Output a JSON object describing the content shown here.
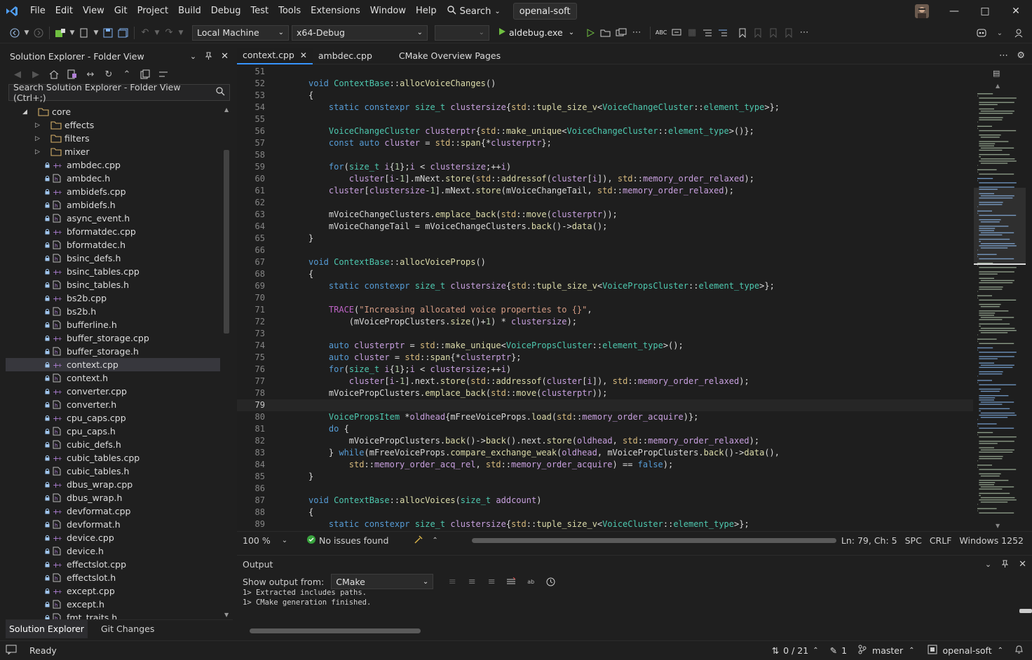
{
  "menu": {
    "items": [
      "File",
      "Edit",
      "View",
      "Git",
      "Project",
      "Build",
      "Debug",
      "Test",
      "Tools",
      "Extensions",
      "Window",
      "Help"
    ],
    "search_label": "Search",
    "solution_name": "openal-soft"
  },
  "toolbar": {
    "target_machine": "Local Machine",
    "configuration": "x64-Debug",
    "empty_dropdown": "",
    "startup_item": "aldebug.exe"
  },
  "sidebar": {
    "title": "Solution Explorer - Folder View",
    "search_placeholder": "Search Solution Explorer - Folder View (Ctrl+;)",
    "tree": [
      {
        "label": "core",
        "type": "folder",
        "expanded": true,
        "level": 1
      },
      {
        "label": "effects",
        "type": "folder",
        "expanded": false,
        "level": 2
      },
      {
        "label": "filters",
        "type": "folder",
        "expanded": false,
        "level": 2
      },
      {
        "label": "mixer",
        "type": "folder",
        "expanded": false,
        "level": 2
      },
      {
        "label": "ambdec.cpp",
        "type": "cpp"
      },
      {
        "label": "ambdec.h",
        "type": "h"
      },
      {
        "label": "ambidefs.cpp",
        "type": "cpp"
      },
      {
        "label": "ambidefs.h",
        "type": "h"
      },
      {
        "label": "async_event.h",
        "type": "h"
      },
      {
        "label": "bformatdec.cpp",
        "type": "cpp"
      },
      {
        "label": "bformatdec.h",
        "type": "h"
      },
      {
        "label": "bsinc_defs.h",
        "type": "h"
      },
      {
        "label": "bsinc_tables.cpp",
        "type": "cpp"
      },
      {
        "label": "bsinc_tables.h",
        "type": "h"
      },
      {
        "label": "bs2b.cpp",
        "type": "cpp"
      },
      {
        "label": "bs2b.h",
        "type": "h"
      },
      {
        "label": "bufferline.h",
        "type": "h"
      },
      {
        "label": "buffer_storage.cpp",
        "type": "cpp"
      },
      {
        "label": "buffer_storage.h",
        "type": "h"
      },
      {
        "label": "context.cpp",
        "type": "cpp",
        "selected": true
      },
      {
        "label": "context.h",
        "type": "h"
      },
      {
        "label": "converter.cpp",
        "type": "cpp"
      },
      {
        "label": "converter.h",
        "type": "h"
      },
      {
        "label": "cpu_caps.cpp",
        "type": "cpp"
      },
      {
        "label": "cpu_caps.h",
        "type": "h"
      },
      {
        "label": "cubic_defs.h",
        "type": "h"
      },
      {
        "label": "cubic_tables.cpp",
        "type": "cpp"
      },
      {
        "label": "cubic_tables.h",
        "type": "h"
      },
      {
        "label": "dbus_wrap.cpp",
        "type": "cpp"
      },
      {
        "label": "dbus_wrap.h",
        "type": "h"
      },
      {
        "label": "devformat.cpp",
        "type": "cpp"
      },
      {
        "label": "devformat.h",
        "type": "h"
      },
      {
        "label": "device.cpp",
        "type": "cpp"
      },
      {
        "label": "device.h",
        "type": "h"
      },
      {
        "label": "effectslot.cpp",
        "type": "cpp"
      },
      {
        "label": "effectslot.h",
        "type": "h"
      },
      {
        "label": "except.cpp",
        "type": "cpp"
      },
      {
        "label": "except.h",
        "type": "h"
      },
      {
        "label": "fmt_traits.h",
        "type": "h"
      }
    ],
    "tabs": [
      "Solution Explorer",
      "Git Changes"
    ]
  },
  "editor": {
    "tabs": [
      {
        "label": "context.cpp",
        "active": true
      },
      {
        "label": "ambdec.cpp",
        "active": false
      },
      {
        "label": "CMake Overview Pages",
        "active": false
      }
    ],
    "current_line": 79,
    "lines": [
      {
        "n": "51",
        "code": ""
      },
      {
        "n": "52",
        "code": "void ContextBase::allocVoiceChanges()"
      },
      {
        "n": "53",
        "code": "{"
      },
      {
        "n": "54",
        "code": "    static constexpr size_t clustersize{std::tuple_size_v<VoiceChangeCluster::element_type>};"
      },
      {
        "n": "55",
        "code": ""
      },
      {
        "n": "56",
        "code": "    VoiceChangeCluster clusterptr{std::make_unique<VoiceChangeCluster::element_type>()};"
      },
      {
        "n": "57",
        "code": "    const auto cluster = std::span{*clusterptr};"
      },
      {
        "n": "58",
        "code": ""
      },
      {
        "n": "59",
        "code": "    for(size_t i{1};i < clustersize;++i)"
      },
      {
        "n": "60",
        "code": "        cluster[i-1].mNext.store(std::addressof(cluster[i]), std::memory_order_relaxed);"
      },
      {
        "n": "61",
        "code": "    cluster[clustersize-1].mNext.store(mVoiceChangeTail, std::memory_order_relaxed);"
      },
      {
        "n": "62",
        "code": ""
      },
      {
        "n": "63",
        "code": "    mVoiceChangeClusters.emplace_back(std::move(clusterptr));"
      },
      {
        "n": "64",
        "code": "    mVoiceChangeTail = mVoiceChangeClusters.back()->data();"
      },
      {
        "n": "65",
        "code": "}"
      },
      {
        "n": "66",
        "code": ""
      },
      {
        "n": "67",
        "code": "void ContextBase::allocVoiceProps()"
      },
      {
        "n": "68",
        "code": "{"
      },
      {
        "n": "69",
        "code": "    static constexpr size_t clustersize{std::tuple_size_v<VoicePropsCluster::element_type>};"
      },
      {
        "n": "70",
        "code": ""
      },
      {
        "n": "71",
        "code": "    TRACE(\"Increasing allocated voice properties to {}\","
      },
      {
        "n": "72",
        "code": "        (mVoicePropClusters.size()+1) * clustersize);"
      },
      {
        "n": "73",
        "code": ""
      },
      {
        "n": "74",
        "code": "    auto clusterptr = std::make_unique<VoicePropsCluster::element_type>();"
      },
      {
        "n": "75",
        "code": "    auto cluster = std::span{*clusterptr};"
      },
      {
        "n": "76",
        "code": "    for(size_t i{1};i < clustersize;++i)"
      },
      {
        "n": "77",
        "code": "        cluster[i-1].next.store(std::addressof(cluster[i]), std::memory_order_relaxed);"
      },
      {
        "n": "78",
        "code": "    mVoicePropClusters.emplace_back(std::move(clusterptr));"
      },
      {
        "n": "79",
        "code": ""
      },
      {
        "n": "80",
        "code": "    VoicePropsItem *oldhead{mFreeVoiceProps.load(std::memory_order_acquire)};"
      },
      {
        "n": "81",
        "code": "    do {"
      },
      {
        "n": "82",
        "code": "        mVoicePropClusters.back()->back().next.store(oldhead, std::memory_order_relaxed);"
      },
      {
        "n": "83",
        "code": "    } while(mFreeVoiceProps.compare_exchange_weak(oldhead, mVoicePropClusters.back()->data(),"
      },
      {
        "n": "84",
        "code": "        std::memory_order_acq_rel, std::memory_order_acquire) == false);"
      },
      {
        "n": "85",
        "code": "}"
      },
      {
        "n": "86",
        "code": ""
      },
      {
        "n": "87",
        "code": "void ContextBase::allocVoices(size_t addcount)"
      },
      {
        "n": "88",
        "code": "{"
      },
      {
        "n": "89",
        "code": "    static constexpr size_t clustersize{std::tuple_size_v<VoiceCluster::element_type>};"
      }
    ],
    "status": {
      "zoom": "100 %",
      "issues": "No issues found",
      "position": "Ln: 79, Ch: 5",
      "whitespace": "SPC",
      "line_ending": "CRLF",
      "encoding": "Windows 1252"
    }
  },
  "output": {
    "title": "Output",
    "show_from_label": "Show output from:",
    "source": "CMake",
    "lines": [
      "1> Extracted includes paths.",
      "1> CMake generation finished."
    ]
  },
  "statusbar": {
    "state": "Ready",
    "commits": "0 / 21",
    "changes": "1",
    "branch": "master",
    "repo": "openal-soft"
  },
  "colors": {
    "accent": "#3794ff",
    "keyword": "#569cd6",
    "type": "#4ec9b0",
    "function": "#dcdcaa",
    "string": "#d69d85",
    "member": "#c8a0df",
    "build_icon": "#6fbf40"
  }
}
